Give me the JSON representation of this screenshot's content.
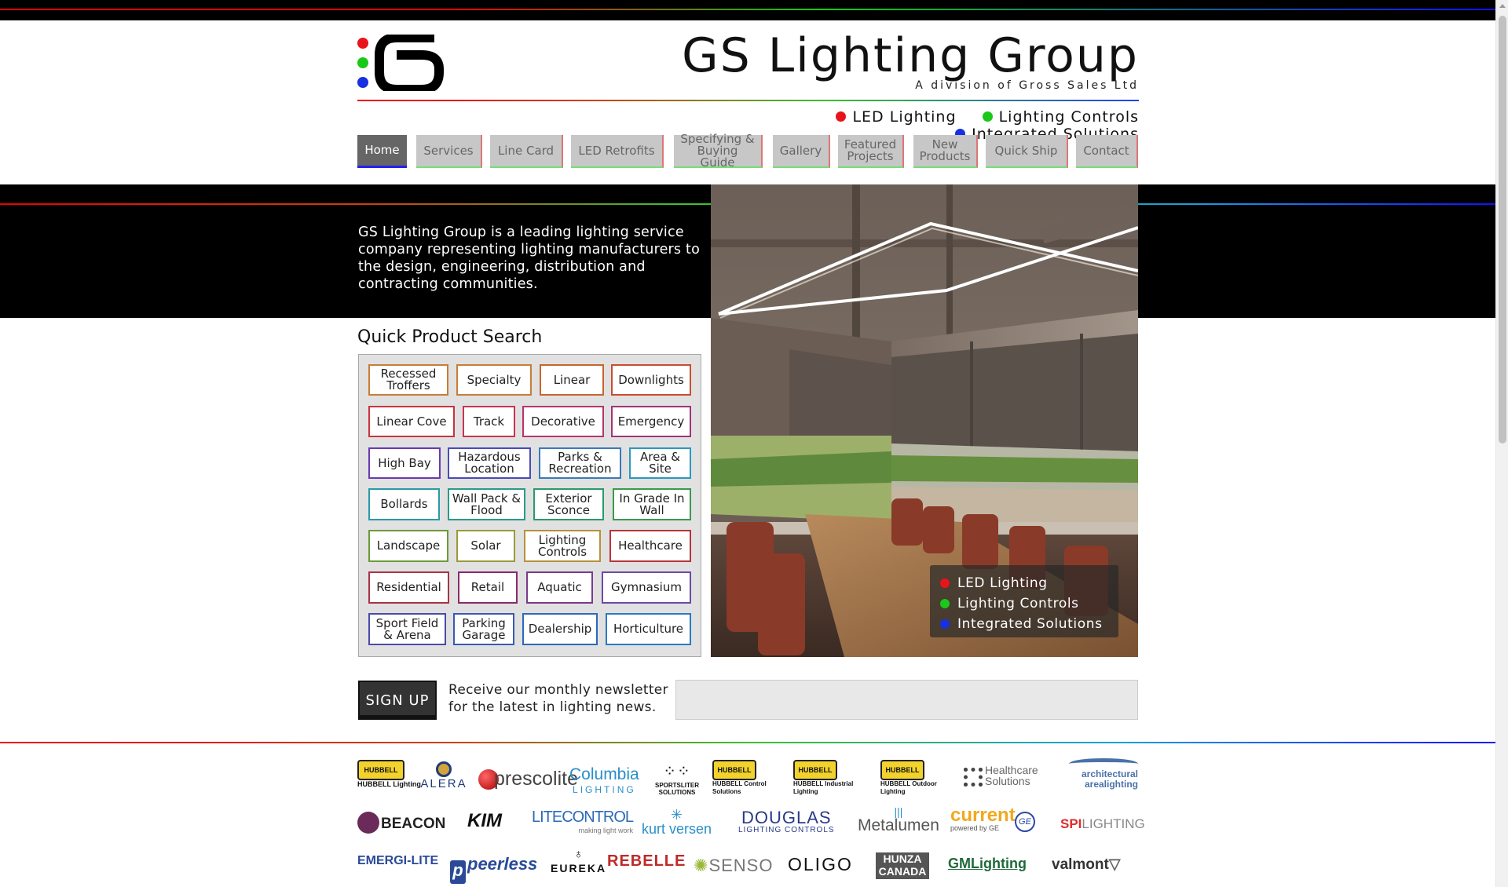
{
  "header": {
    "title": "GS Lighting Group",
    "subtitle": "A division of Gross Sales Ltd",
    "tags": [
      {
        "label": "LED Lighting",
        "color": "#e8141c"
      },
      {
        "label": "Lighting Controls",
        "color": "#19c819"
      },
      {
        "label": "Integrated Solutions",
        "color": "#1830e0"
      }
    ]
  },
  "nav": {
    "items": [
      "Home",
      "Services",
      "Line Card",
      "LED Retrofits",
      "Specifying & Buying Guide",
      "Gallery",
      "Featured Projects",
      "New Products",
      "Quick Ship",
      "Contact"
    ],
    "active": "Home"
  },
  "intro": "GS Lighting Group is a leading lighting service company representing lighting manufacturers to the design, engineering, distribution and contracting communities.",
  "overlay": {
    "items": [
      {
        "label": "LED Lighting",
        "color": "#e8141c"
      },
      {
        "label": "Lighting Controls",
        "color": "#19c819"
      },
      {
        "label": "Integrated Solutions",
        "color": "#1830e0"
      }
    ]
  },
  "quick_search": {
    "title": "Quick Product Search",
    "buttons": [
      "Recessed Troffers",
      "Specialty",
      "Linear",
      "Downlights",
      "Linear Cove",
      "Track",
      "Decorative",
      "Emergency",
      "High Bay",
      "Hazardous Location",
      "Parks & Recreation",
      "Area & Site",
      "Bollards",
      "Wall Pack & Flood",
      "Exterior Sconce",
      "In Grade In Wall",
      "Landscape",
      "Solar",
      "Lighting Controls",
      "Healthcare",
      "Residential",
      "Retail",
      "Aquatic",
      "Gymnasium",
      "Sport Field & Arena",
      "Parking Garage",
      "Dealership",
      "Horticulture"
    ]
  },
  "signup": {
    "button": "SIGN UP",
    "line1": "Receive our monthly newsletter",
    "line2": "for the latest in lighting news.",
    "placeholder": ""
  },
  "brands": [
    "HUBBELL Lighting",
    "ALERA",
    "prescolite",
    "Columbia",
    "LIGHTING",
    "SPORTSLITER SOLUTIONS",
    "HUBBELL Control Solutions",
    "HUBBELL Industrial Lighting",
    "HUBBELL Outdoor Lighting",
    "Healthcare",
    "Solutions",
    "architectural",
    "arealighting",
    "BEACON",
    "KIM",
    "LITECONTROL",
    "making light work",
    "kurt versen",
    "DOUGLAS",
    "LIGHTING CONTROLS",
    "Metalumen",
    "current",
    "powered by GE",
    "SPI",
    "LIGHTING",
    "EMERGI-LITE",
    "peerless",
    "EUREKA",
    "REBELLE",
    "SENSO",
    "OLIGO",
    "HUNZA",
    "CANADA",
    "GMLighting",
    "valmont"
  ]
}
